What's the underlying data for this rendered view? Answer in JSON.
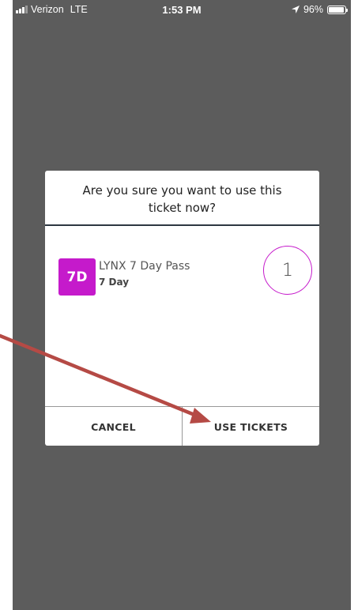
{
  "status_bar": {
    "carrier": "Verizon",
    "network": "LTE",
    "time": "1:53 PM",
    "location_icon": "location-arrow-icon",
    "battery": "96%",
    "battery_level": 0.96
  },
  "dialog": {
    "title": "Are you sure you want to use this ticket now?",
    "ticket": {
      "badge": "7D",
      "name": "LYNX 7 Day Pass",
      "duration": "7 Day",
      "quantity": "1"
    },
    "cancel_label": "CANCEL",
    "confirm_label": "USE TICKETS"
  },
  "colors": {
    "overlay": "#5c5c5c",
    "accent": "#c51acb",
    "annotation_arrow": "#b54a45"
  }
}
